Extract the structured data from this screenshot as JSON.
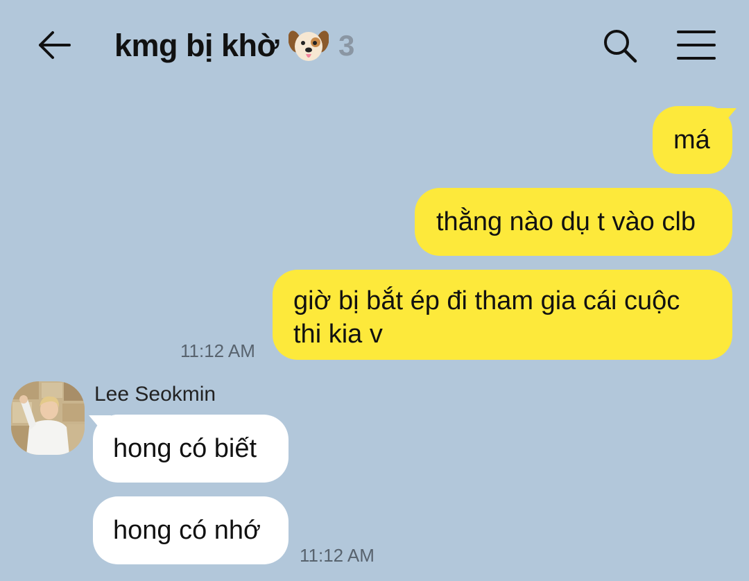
{
  "header": {
    "title": "kmg bị khờ",
    "title_emoji_icon": "dog-face-icon",
    "member_count": "3",
    "back_icon": "arrow-left-icon",
    "search_icon": "search-icon",
    "menu_icon": "hamburger-menu-icon"
  },
  "colors": {
    "background": "#b2c7da",
    "outgoing_bubble": "#fde93b",
    "incoming_bubble": "#ffffff",
    "timestamp": "#58636e",
    "member_count": "#8a96a3"
  },
  "messages": [
    {
      "direction": "out",
      "text": "má"
    },
    {
      "direction": "out",
      "text": "thằng nào dụ t vào clb"
    },
    {
      "direction": "out",
      "lines": [
        "giờ bị bắt ép đi tham gia cái cuộc",
        "thi kia v"
      ],
      "time": "11:12 AM"
    },
    {
      "direction": "in",
      "sender": "Lee Seokmin",
      "avatar_icon": "user-avatar-photo",
      "text": "hong có biết"
    },
    {
      "direction": "in",
      "text": "hong có nhớ",
      "time": "11:12 AM"
    }
  ]
}
